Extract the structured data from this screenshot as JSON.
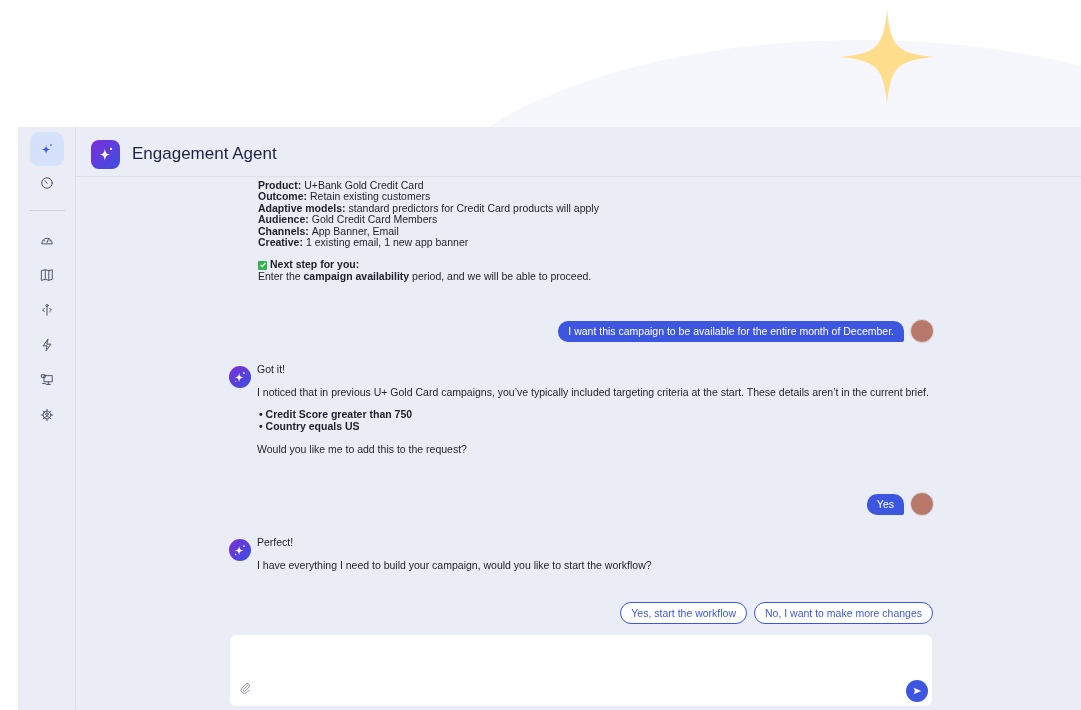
{
  "app": {
    "title": "Engagement Agent"
  },
  "sidebar": {
    "items": [
      {
        "selected": true
      },
      {
        "selected": false
      },
      {
        "selected": false
      },
      {
        "selected": false
      },
      {
        "selected": false
      },
      {
        "selected": false
      },
      {
        "selected": false
      },
      {
        "selected": false
      }
    ]
  },
  "brief": [
    {
      "label": "Product:",
      "value": "U+Bank Gold Credit Card"
    },
    {
      "label": "Outcome:",
      "value": "Retain existing customers"
    },
    {
      "label": "Adaptive models:",
      "value": "standard predictors for Credit Card products will apply"
    },
    {
      "label": "Audience:",
      "value": "Gold Credit Card Members"
    },
    {
      "label": "Channels:",
      "value": "App Banner, Email"
    },
    {
      "label": "Creative:",
      "value": "1 existing email, 1 new app banner"
    }
  ],
  "next_step": {
    "title": "Next step for you:",
    "text": "Enter the **campaign availability** period, and we will be able to proceed."
  },
  "messages": [
    {
      "kind": "user",
      "text": "I want this campaign to be available for the entire month of December."
    },
    {
      "kind": "agent",
      "blocks": [
        {
          "kind": "p",
          "text": "Got it!"
        },
        {
          "kind": "p",
          "text": "I noticed that in previous U+ Gold Card campaigns, you’ve typically included targeting criteria at the start. These details aren’t in the current brief."
        },
        {
          "kind": "bullets",
          "items": [
            "• Credit Score greater than 750",
            "• Country equals US"
          ]
        },
        {
          "kind": "p",
          "text": "Would you like me to add this to the request?"
        }
      ]
    },
    {
      "kind": "user",
      "text": "Yes"
    },
    {
      "kind": "agent",
      "blocks": [
        {
          "kind": "p",
          "text": "Perfect!"
        },
        {
          "kind": "p",
          "text": "I have everything I need to build your campaign, would you like to start the workflow?"
        }
      ]
    }
  ],
  "quick_replies": [
    "Yes, start the workflow",
    "No, I want to make more changes"
  ]
}
